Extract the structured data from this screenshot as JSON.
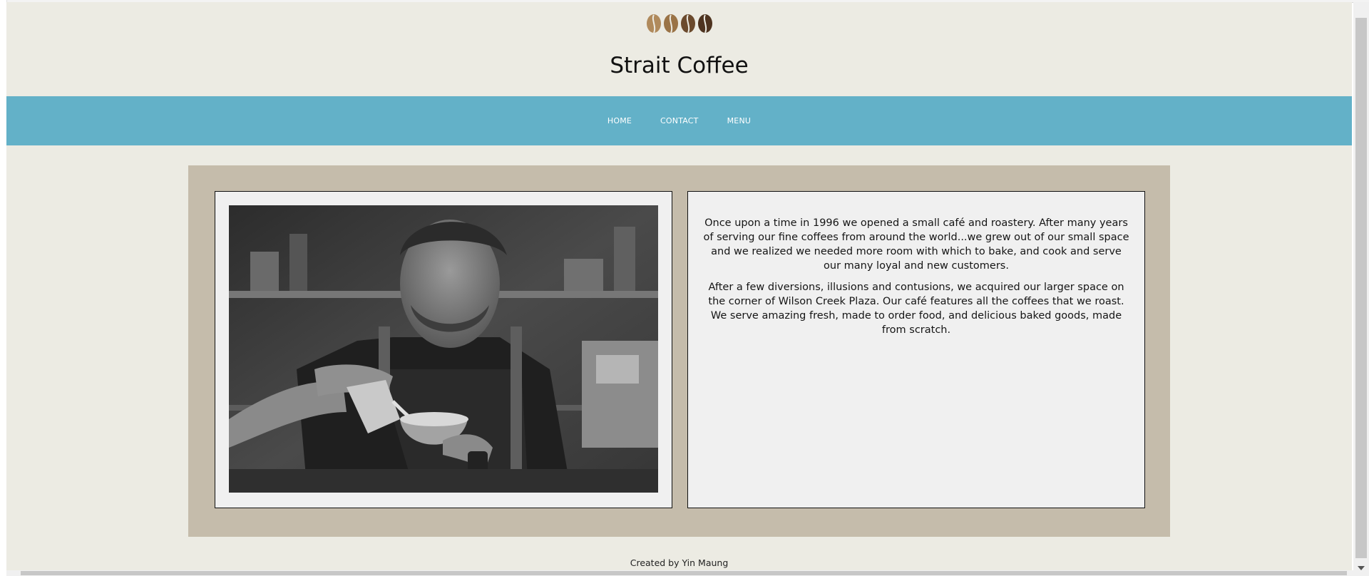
{
  "header": {
    "title": "Strait Coffee",
    "logo_icon": "coffee-beans-logo"
  },
  "nav": {
    "items": [
      {
        "label": "HOME"
      },
      {
        "label": "CONTACT"
      },
      {
        "label": "MENU"
      }
    ]
  },
  "main": {
    "photo_icon": "barista-pouring-latte-photo",
    "about_paragraphs": [
      "Once upon a time in 1996 we opened a small café and roastery. After many years of serving our fine coffees from around the world...we grew out of our small space and we realized we needed more room with which to bake, and cook and serve our many loyal and new customers.",
      "After a few diversions, illusions and contusions, we acquired our larger space on the corner of Wilson Creek Plaza. Our café features all the coffees that we roast. We serve amazing fresh, made to order food, and delicious baked goods, made from scratch."
    ]
  },
  "footer": {
    "credit": "Created by Yin Maung"
  },
  "colors": {
    "page_bg": "#ecebe3",
    "nav_bg": "#63b1c8",
    "frame_bg": "#c5bcab",
    "card_bg": "#f0f0f0"
  }
}
